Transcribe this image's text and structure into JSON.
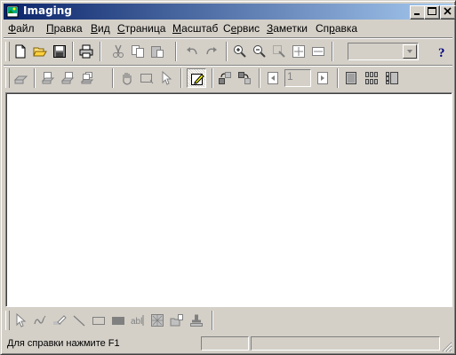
{
  "window": {
    "title": "Imaging"
  },
  "title_buttons": {
    "minimize": "_",
    "maximize": "□",
    "close": "×"
  },
  "menu": [
    {
      "label": "Файл",
      "accel": "Ф",
      "rest": "айл"
    },
    {
      "label": "Правка",
      "accel": "П",
      "rest": "равка"
    },
    {
      "label": "Вид",
      "accel": "В",
      "rest": "ид"
    },
    {
      "label": "Страница",
      "accel": "С",
      "rest": "траница"
    },
    {
      "label": "Масштаб",
      "accel": "М",
      "rest": "асштаб"
    },
    {
      "label": "Сервис",
      "accel": "е",
      "pre": "С",
      "rest": "рвис"
    },
    {
      "label": "Заметки",
      "accel": "З",
      "rest": "аметки"
    },
    {
      "label": "Справка",
      "accel": "р",
      "pre": "Сп",
      "rest": "авка"
    }
  ],
  "toolbar1": {
    "buttons": [
      "new-icon",
      "open-icon",
      "save-icon",
      "print-icon",
      "cut-icon",
      "copy-icon",
      "paste-icon",
      "undo-icon",
      "redo-icon",
      "zoom-in-icon",
      "zoom-out-icon",
      "zoom-to-selection-icon",
      "best-fit-icon",
      "fit-to-width-icon",
      "help-icon"
    ],
    "zoom_combo_value": ""
  },
  "toolbar2": {
    "page_number": "1",
    "buttons": [
      "scan-icon",
      "insert-scan-icon",
      "append-scan-icon",
      "rescan-icon",
      "drag-icon",
      "select-image-icon",
      "annotation-selection-icon",
      "annotation-toolbar-icon",
      "rotate-left-icon",
      "rotate-right-icon",
      "previous-page-icon",
      "next-page-icon",
      "one-page-view-icon",
      "thumbnail-view-icon",
      "page-and-thumbnails-view-icon"
    ]
  },
  "annotation_toolbar": {
    "buttons": [
      "annotation-select-icon",
      "freehand-line-icon",
      "highlighter-icon",
      "straight-line-icon",
      "hollow-rectangle-icon",
      "filled-rectangle-icon",
      "typed-text-icon",
      "attach-a-note-icon",
      "text-from-file-icon",
      "rubber-stamp-icon"
    ],
    "text_label": "abl"
  },
  "status": {
    "text": "Для справки нажмите F1"
  },
  "colors": {
    "title_start": "#0a246a",
    "title_end": "#a6caf0",
    "face": "#d4d0c8"
  }
}
